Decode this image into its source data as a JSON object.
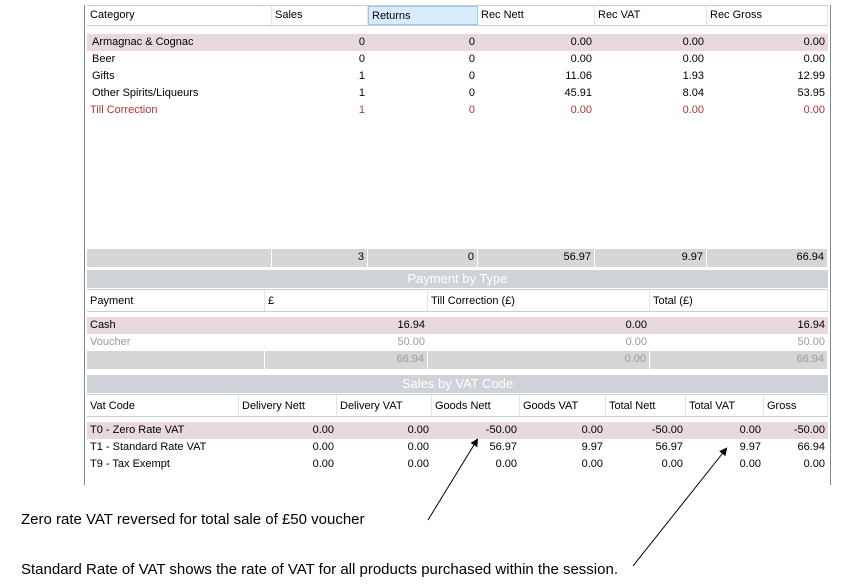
{
  "category_table": {
    "headers": [
      "Category",
      "Sales",
      "Returns",
      "Rec Nett",
      "Rec VAT",
      "Rec Gross"
    ],
    "rows": [
      [
        "Armagnac & Cognac",
        "0",
        "0",
        "0.00",
        "0.00",
        "0.00"
      ],
      [
        "Beer",
        "0",
        "0",
        "0.00",
        "0.00",
        "0.00"
      ],
      [
        "Gifts",
        "1",
        "0",
        "11.06",
        "1.93",
        "12.99"
      ],
      [
        "Other Spirits/Liqueurs",
        "1",
        "0",
        "45.91",
        "8.04",
        "53.95"
      ],
      [
        "Till Correction",
        "1",
        "0",
        "0.00",
        "0.00",
        "0.00"
      ]
    ],
    "totals": [
      "",
      "3",
      "0",
      "56.97",
      "9.97",
      "66.94"
    ]
  },
  "payment_section": {
    "title": "Payment by Type",
    "headers": [
      "Payment",
      "£",
      "Till Correction (£)",
      "Total (£)"
    ],
    "rows": [
      [
        "Cash",
        "16.94",
        "0.00",
        "16.94"
      ],
      [
        "Voucher",
        "50.00",
        "0.00",
        "50.00"
      ]
    ],
    "totals": [
      "",
      "66.94",
      "0.00",
      "66.94"
    ]
  },
  "vat_section": {
    "title": "Sales by VAT Code",
    "headers": [
      "Vat Code",
      "Delivery Nett",
      "Delivery VAT",
      "Goods Nett",
      "Goods VAT",
      "Total Nett",
      "Total VAT",
      "Gross"
    ],
    "rows": [
      [
        "T0 - Zero Rate VAT",
        "0.00",
        "0.00",
        "-50.00",
        "0.00",
        "-50.00",
        "0.00",
        "-50.00"
      ],
      [
        "T1 - Standard Rate VAT",
        "0.00",
        "0.00",
        "56.97",
        "9.97",
        "56.97",
        "9.97",
        "66.94"
      ],
      [
        "T9 - Tax Exempt",
        "0.00",
        "0.00",
        "0.00",
        "0.00",
        "0.00",
        "0.00",
        "0.00"
      ]
    ]
  },
  "annotations": {
    "zero_rate": "Zero rate VAT reversed for total sale of £50 voucher",
    "standard_rate": "Standard Rate of VAT shows the rate of VAT for all products purchased within the session."
  }
}
